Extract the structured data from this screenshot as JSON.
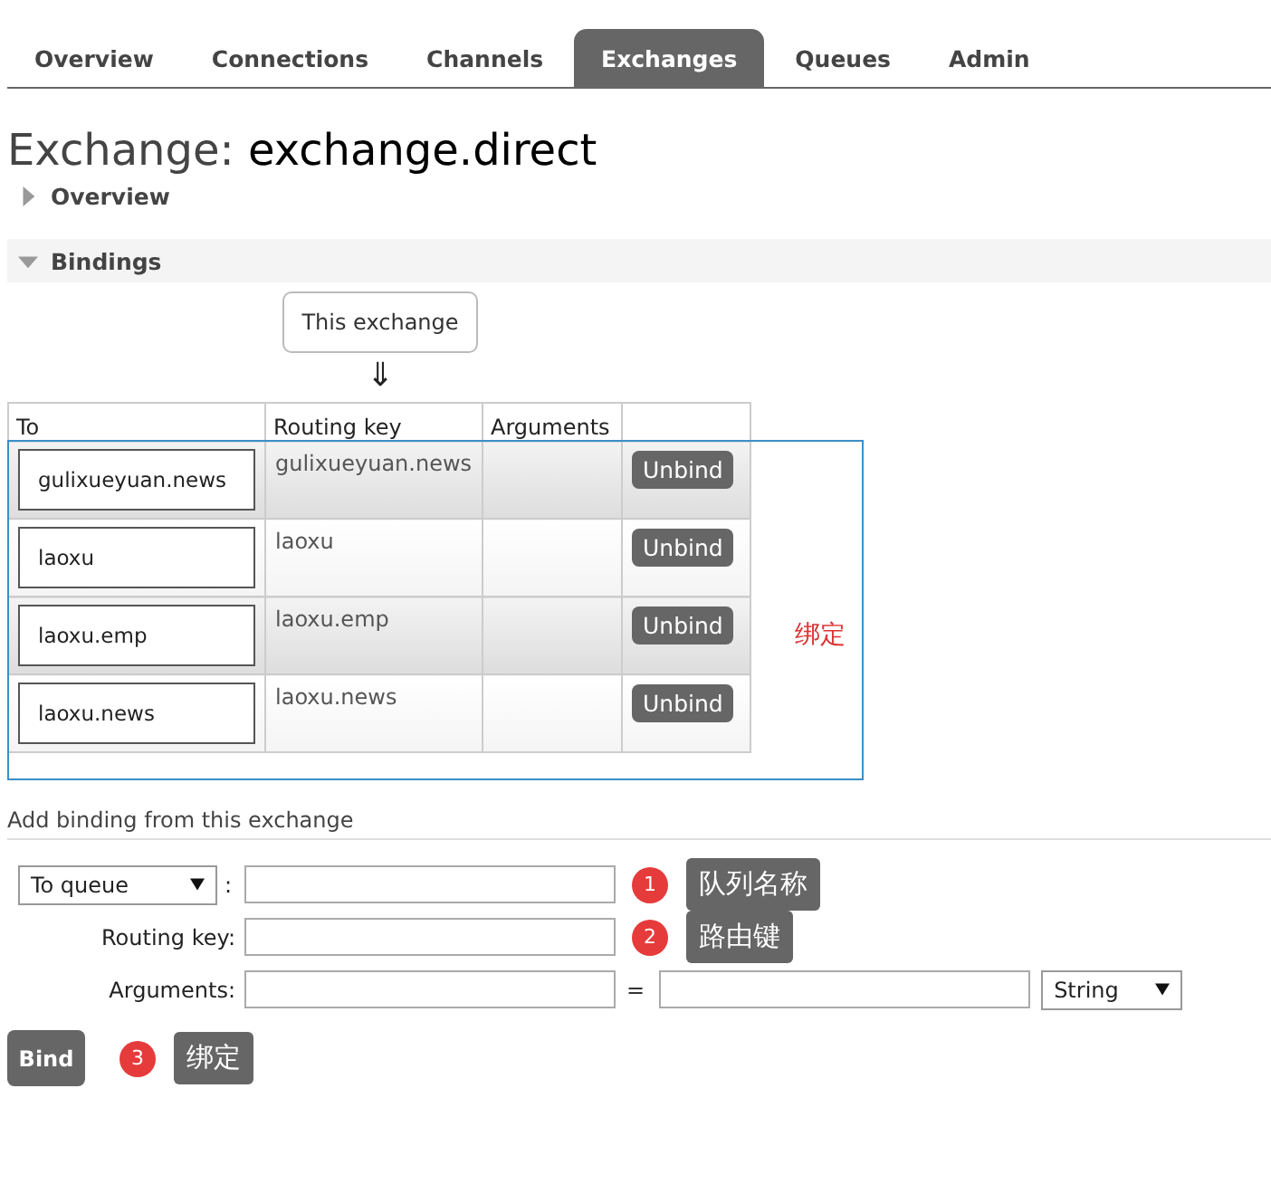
{
  "tabs": [
    {
      "label": "Overview",
      "selected": false
    },
    {
      "label": "Connections",
      "selected": false
    },
    {
      "label": "Channels",
      "selected": false
    },
    {
      "label": "Exchanges",
      "selected": true
    },
    {
      "label": "Queues",
      "selected": false
    },
    {
      "label": "Admin",
      "selected": false
    }
  ],
  "title": {
    "prefix": "Exchange:",
    "name": "exchange.direct"
  },
  "sections": [
    {
      "label": "Overview",
      "expanded": false,
      "shaded": false
    },
    {
      "label": "Bindings",
      "expanded": true,
      "shaded": true
    }
  ],
  "bindings": {
    "source": "This exchange",
    "arrow": "⇓",
    "columns": [
      "To",
      "Routing key",
      "Arguments"
    ],
    "rows": [
      {
        "to": "gulixueyuan.news",
        "routing_key": "gulixueyuan.news",
        "action": "Unbind"
      },
      {
        "to": "laoxu",
        "routing_key": "laoxu",
        "action": "Unbind"
      },
      {
        "to": "laoxu.emp",
        "routing_key": "laoxu.emp",
        "action": "Unbind"
      },
      {
        "to": "laoxu.news",
        "routing_key": "laoxu.news",
        "action": "Unbind"
      }
    ],
    "annotation": "绑定"
  },
  "add_binding": {
    "heading": "Add binding from this exchange",
    "destination_select": "To queue",
    "colon": ":",
    "routing_key_label": "Routing key:",
    "arguments_label": "Arguments:",
    "equals": "=",
    "type_select": "String",
    "bind_button": "Bind",
    "callouts": [
      {
        "number": "1",
        "text": "队列名称"
      },
      {
        "number": "2",
        "text": "路由键"
      },
      {
        "number": "3",
        "text": "绑定"
      }
    ]
  }
}
